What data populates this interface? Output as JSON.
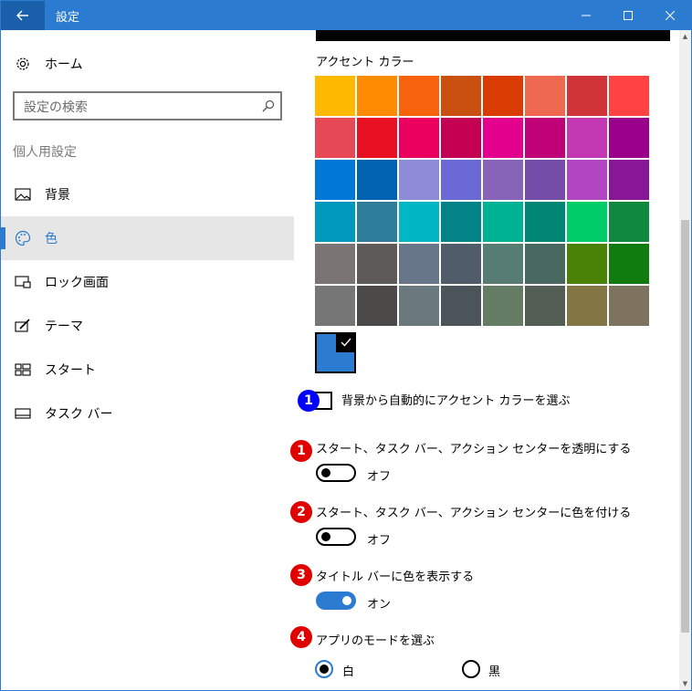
{
  "window": {
    "title": "設定"
  },
  "sidebar": {
    "home_label": "ホーム",
    "search_placeholder": "設定の検索",
    "section_heading": "個人用設定",
    "items": [
      {
        "label": "背景",
        "icon": "picture-icon"
      },
      {
        "label": "色",
        "icon": "palette-icon",
        "selected": true
      },
      {
        "label": "ロック画面",
        "icon": "lock-screen-icon"
      },
      {
        "label": "テーマ",
        "icon": "theme-icon"
      },
      {
        "label": "スタート",
        "icon": "start-icon"
      },
      {
        "label": "タスク バー",
        "icon": "taskbar-icon"
      }
    ]
  },
  "accent": {
    "title": "アクセント カラー",
    "swatches": [
      "#FFB900",
      "#FF8C00",
      "#F7630C",
      "#CA5010",
      "#DA3B01",
      "#EF6950",
      "#D13438",
      "#FF4343",
      "#E74856",
      "#E81123",
      "#EA005E",
      "#C30052",
      "#E3008C",
      "#BF0077",
      "#C239B3",
      "#9A0089",
      "#0078D7",
      "#0063B1",
      "#8E8CD8",
      "#6B69D6",
      "#8764B8",
      "#744DA9",
      "#B146C2",
      "#881798",
      "#0099BC",
      "#2D7D9A",
      "#00B7C3",
      "#038387",
      "#00B294",
      "#018574",
      "#00CC6A",
      "#10893E",
      "#7A7574",
      "#5D5A58",
      "#68768A",
      "#515C6B",
      "#567C73",
      "#486860",
      "#498205",
      "#107C10",
      "#767676",
      "#4C4A48",
      "#69797E",
      "#4A5459",
      "#647C64",
      "#525E54",
      "#847545",
      "#7E735F"
    ],
    "custom_color": "#2B7BD0",
    "auto_pick_label": "背景から自動的にアクセント カラーを選ぶ"
  },
  "settings": {
    "transparent": {
      "label": "スタート、タスク バー、アクション センターを透明にする",
      "state": "オフ",
      "on": false
    },
    "color_start": {
      "label": "スタート、タスク バー、アクション センターに色を付ける",
      "state": "オフ",
      "on": false
    },
    "title_bar": {
      "label": "タイトル バーに色を表示する",
      "state": "オン",
      "on": true
    },
    "app_mode": {
      "label": "アプリのモードを選ぶ",
      "options": [
        "白",
        "黒"
      ],
      "selected": "白"
    }
  },
  "badges": [
    "1",
    "1",
    "2",
    "3",
    "4"
  ],
  "colors": {
    "accent": "#2B7BD0",
    "badge_blue": "#0000FF",
    "badge_red": "#E00000"
  }
}
